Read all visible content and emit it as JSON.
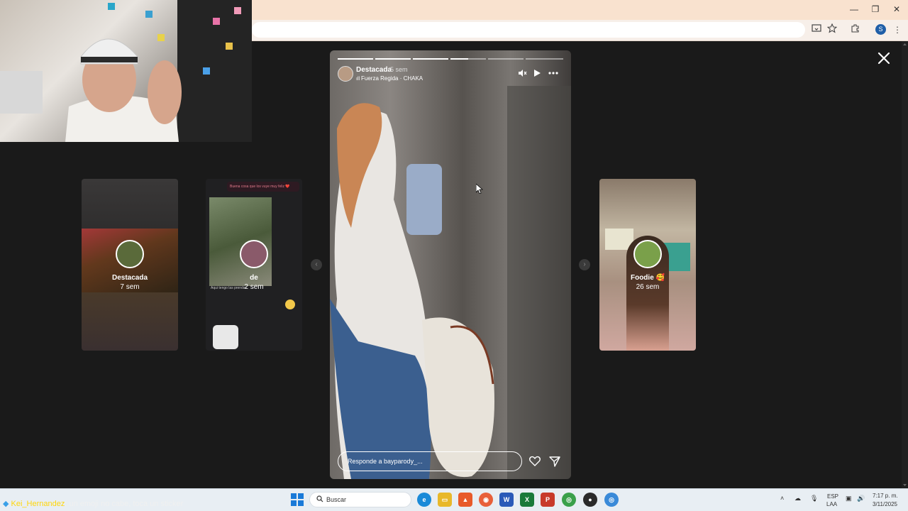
{
  "browser": {
    "window_controls": {
      "minimize": "—",
      "restore": "❐",
      "close": "✕"
    },
    "toolbar_icons": [
      "cast-icon",
      "bookmark-star-icon",
      "extensions-icon",
      "profile-avatar",
      "menu-icon"
    ],
    "profile_initial": "S"
  },
  "story_viewer": {
    "main": {
      "username": "Destacada",
      "time": "5 sem",
      "song": "Fuerza Regida · CHAKA",
      "reply_placeholder": "Responde a bayparody_...",
      "progress": {
        "segments": 6,
        "completed": 3,
        "current_fraction": 0.5
      }
    },
    "side_stories": [
      {
        "title": "Destacada",
        "time": "7 sem"
      },
      {
        "title": "de",
        "time": "2 sem"
      },
      {
        "title": "Foodie 🥰",
        "time": "26 sem"
      }
    ],
    "card2_texts": {
      "top_bubble": "Buena cosa que los vuye muy feliz ❤️",
      "bottom_caption": "Aqui tengo las prendas"
    }
  },
  "taskbar": {
    "chat_user": "Kei_Hernandez",
    "chat_text": ": un emoji no cabe, toca un sticker",
    "search_label": "Buscar",
    "apps": [
      "edge",
      "files",
      "brave",
      "firefox",
      "word",
      "excel",
      "powerpoint",
      "chrome",
      "obs",
      "chrome-2"
    ],
    "lang_line1": "ESP",
    "lang_line2": "LAA",
    "time": "7:17 p. m.",
    "date": "3/11/2025"
  },
  "colors": {
    "accent_browser_title": "#f9e2cf",
    "viewer_bg": "#1a1a1a",
    "chat_user_color": "#ffd60a"
  }
}
